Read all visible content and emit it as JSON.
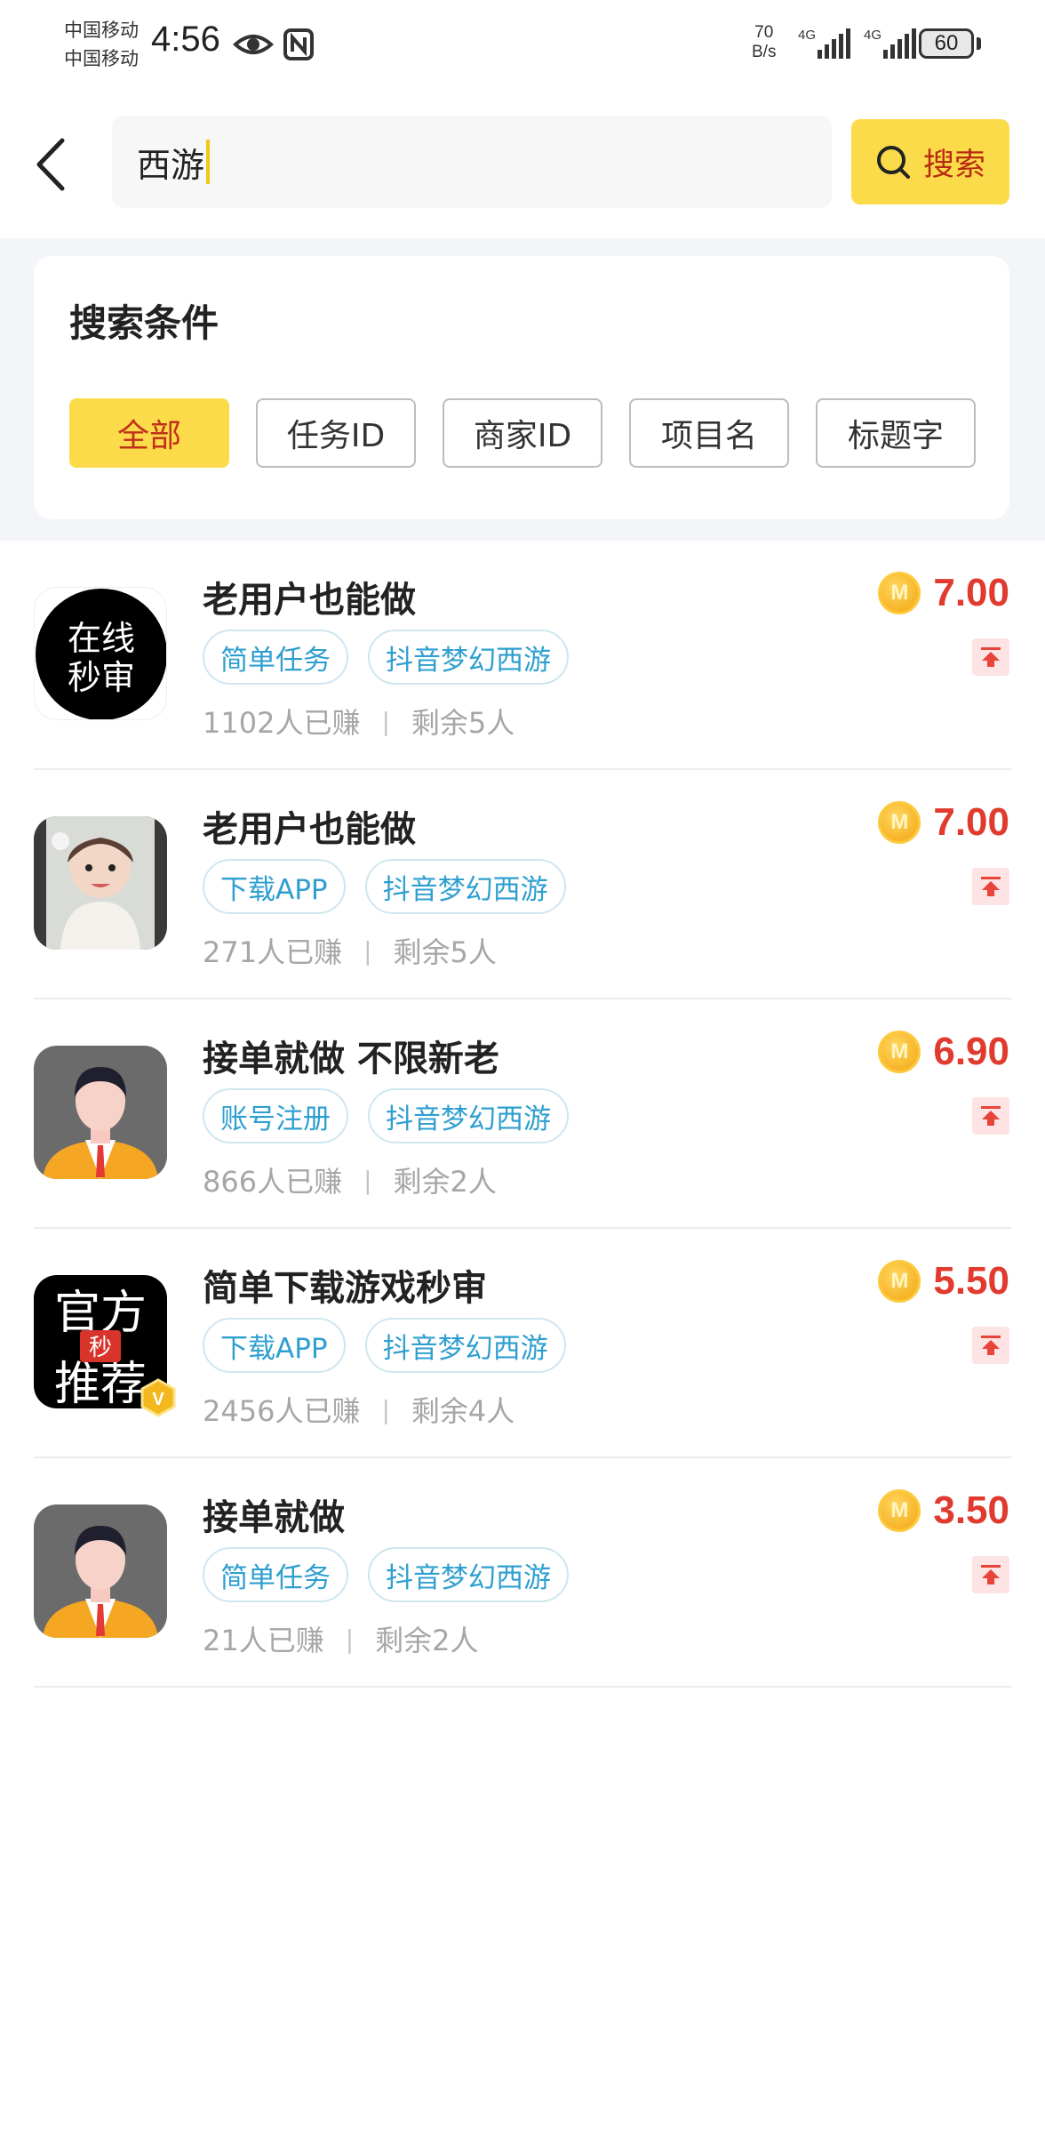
{
  "status_bar": {
    "carrier_1": "中国移动",
    "carrier_2": "中国移动",
    "time": "4:56",
    "net_speed_value": "70",
    "net_speed_unit": "B/s",
    "network_1": "4G",
    "network_2": "4G",
    "battery": "60"
  },
  "header": {
    "search_value": "西游",
    "search_button_label": "搜索",
    "accent_color": "#fbdb4a"
  },
  "conditions": {
    "title": "搜索条件",
    "filters": [
      {
        "label": "全部",
        "active": true
      },
      {
        "label": "任务ID",
        "active": false
      },
      {
        "label": "商家ID",
        "active": false
      },
      {
        "label": "项目名",
        "active": false
      },
      {
        "label": "标题字",
        "active": false
      }
    ]
  },
  "tasks": [
    {
      "title": "老用户也能做",
      "tags": [
        "简单任务",
        "抖音梦幻西游"
      ],
      "earned": "1102人已赚",
      "remaining": "剩余5人",
      "price": "7.00",
      "avatar": "online-review-logo",
      "avatar_text_1": "在线",
      "avatar_text_2": "秒审"
    },
    {
      "title": "老用户也能做",
      "tags": [
        "下载APP",
        "抖音梦幻西游"
      ],
      "earned": "271人已赚",
      "remaining": "剩余5人",
      "price": "7.00",
      "avatar": "child-photo"
    },
    {
      "title": "接单就做 不限新老",
      "tags": [
        "账号注册",
        "抖音梦幻西游"
      ],
      "earned": "866人已赚",
      "remaining": "剩余2人",
      "price": "6.90",
      "avatar": "default-user-avatar"
    },
    {
      "title": "简单下载游戏秒审",
      "tags": [
        "下载APP",
        "抖音梦幻西游"
      ],
      "earned": "2456人已赚",
      "remaining": "剩余4人",
      "price": "5.50",
      "avatar": "official-recommend-logo",
      "avatar_text_1": "官方",
      "avatar_text_2": "推荐",
      "avatar_badge": "秒",
      "verified_badge": "V"
    },
    {
      "title": "接单就做",
      "tags": [
        "简单任务",
        "抖音梦幻西游"
      ],
      "earned": "21人已赚",
      "remaining": "剩余2人",
      "price": "3.50",
      "avatar": "default-user-avatar"
    }
  ],
  "coin_letter": "M",
  "separator": "|",
  "colors": {
    "price": "#e03b2e",
    "tag": "#2f9fd0",
    "filter_active": "#fbdb4a"
  }
}
